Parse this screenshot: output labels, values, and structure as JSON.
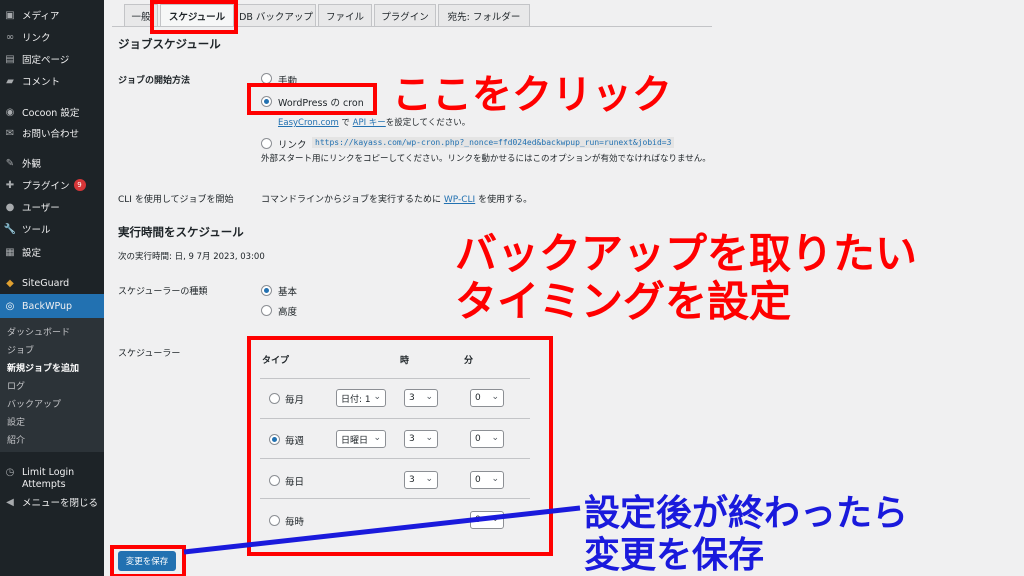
{
  "sidebar": {
    "items": [
      {
        "icon": "media-icon",
        "glyph": "▣",
        "label": "メディア"
      },
      {
        "icon": "link-icon",
        "glyph": "🔗",
        "label": "リンク"
      },
      {
        "icon": "page-icon",
        "glyph": "▤",
        "label": "固定ページ"
      },
      {
        "icon": "comment-icon",
        "glyph": "▰",
        "label": "コメント"
      },
      {
        "icon": "cocoon-icon",
        "glyph": "◉",
        "label": "Cocoon 設定"
      },
      {
        "icon": "mail-icon",
        "glyph": "✉",
        "label": "お問い合わせ"
      },
      {
        "icon": "appearance-icon",
        "glyph": "✎",
        "label": "外観"
      },
      {
        "icon": "plugin-icon",
        "glyph": "✚",
        "label": "プラグイン",
        "badge": "9"
      },
      {
        "icon": "user-icon",
        "glyph": "●",
        "label": "ユーザー"
      },
      {
        "icon": "tools-icon",
        "glyph": "✖",
        "label": "ツール"
      },
      {
        "icon": "settings-icon",
        "glyph": "▦",
        "label": "設定"
      },
      {
        "icon": "siteguard-icon",
        "glyph": "◆",
        "label": "SiteGuard"
      },
      {
        "icon": "backwpup-icon",
        "glyph": "◎",
        "label": "BackWPup"
      }
    ],
    "submenu": [
      "ダッシュボード",
      "ジョブ",
      "新規ジョブを追加",
      "ログ",
      "バックアップ",
      "設定",
      "紹介"
    ],
    "limit_login_1": "Limit Login",
    "limit_login_2": "Attempts",
    "collapse": "メニューを閉じる"
  },
  "tabs": [
    "一般",
    "スケジュール",
    "DB バックアップ",
    "ファイル",
    "プラグイン",
    "宛先: フォルダー"
  ],
  "main": {
    "section_title": "ジョブスケジュール",
    "start_label": "ジョブの開始方法",
    "opt_manual": "手動",
    "opt_cron": "WordPress の cron",
    "easycron_link": "EasyCron.com",
    "easycron_mid": " で ",
    "api_link": "API キー",
    "easycron_end": "を設定してください。",
    "opt_link": "リンク",
    "link_url": "https://kayass.com/wp-cron.php?_nonce=ffd024ed&backwpup_run=runext&jobid=3",
    "link_desc": "外部スタート用にリンクをコピーしてください。リンクを動かせるにはこのオプションが有効でなければなりません。",
    "cli_label": "CLI を使用してジョブを開始",
    "cli_desc": "コマンドラインからジョブを実行するために ",
    "cli_link": "WP-CLI",
    "cli_end": " を使用する。",
    "exec_title": "実行時間をスケジュール",
    "next_run": "次の実行時間: 日, 9 7月 2023, 03:00",
    "type_label": "スケジューラーの種類",
    "type_basic": "基本",
    "type_advanced": "高度",
    "scheduler_label": "スケジューラー",
    "col_type": "タイプ",
    "col_hour": "時",
    "col_min": "分",
    "rows": [
      {
        "label": "毎月",
        "day": "日付: 1",
        "hour": "3",
        "min": "0"
      },
      {
        "label": "毎週",
        "day": "日曜日",
        "hour": "3",
        "min": "0"
      },
      {
        "label": "毎日",
        "hour": "3",
        "min": "0"
      },
      {
        "label": "毎時",
        "min": "0"
      }
    ],
    "save": "変更を保存"
  },
  "annotations": {
    "click_here": "ここをクリック",
    "timing_1": "バックアップを取りたい",
    "timing_2": "タイミングを設定",
    "after_1": "設定後が終わったら",
    "after_2": "変更を保存",
    "red_color": "#ff0000",
    "blue_color": "#1a1adc"
  }
}
